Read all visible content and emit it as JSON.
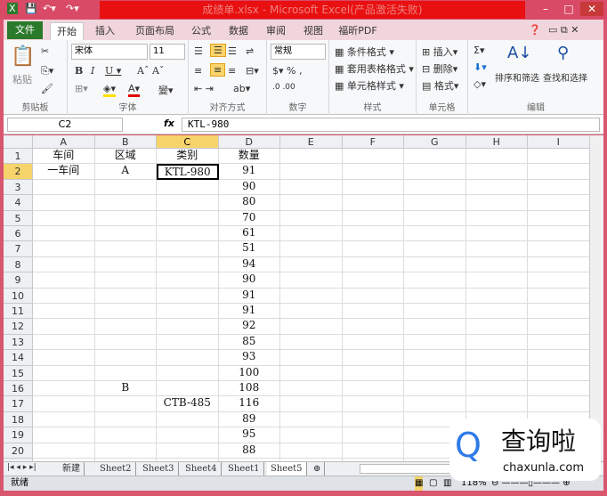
{
  "window": {
    "title": "成绩单.xlsx - Microsoft Excel(产品激活失败)",
    "accent": "#e81010"
  },
  "ribbon_tabs": [
    "文件",
    "开始",
    "插入",
    "页面布局",
    "公式",
    "数据",
    "审阅",
    "视图",
    "福昕PDF"
  ],
  "ribbon": {
    "clipboard": {
      "label": "剪贴板",
      "paste": "粘贴"
    },
    "font": {
      "label": "字体",
      "name": "宋体",
      "size": "11"
    },
    "alignment": {
      "label": "对齐方式"
    },
    "number": {
      "label": "数字",
      "format": "常规"
    },
    "styles": {
      "label": "样式",
      "items": [
        "条件格式",
        "套用表格格式",
        "单元格样式"
      ]
    },
    "cells": {
      "label": "单元格",
      "items": [
        "插入",
        "删除",
        "格式"
      ]
    },
    "editing": {
      "label": "编辑",
      "sort": "排序和筛选",
      "find": "查找和选择"
    }
  },
  "formula_bar": {
    "name_box": "C2",
    "fx": "fx",
    "value": "KTL-980"
  },
  "columns": [
    "A",
    "B",
    "C",
    "D",
    "E",
    "F",
    "G",
    "H",
    "I"
  ],
  "selected_column": "C",
  "rows": [
    [
      "车间",
      "区域",
      "类别",
      "数量"
    ],
    [
      "一车间",
      "A",
      "KTL-980",
      "91"
    ],
    [
      "",
      "",
      "",
      "90"
    ],
    [
      "",
      "",
      "",
      "80"
    ],
    [
      "",
      "",
      "",
      "70"
    ],
    [
      "",
      "",
      "",
      "61"
    ],
    [
      "",
      "",
      "",
      "51"
    ],
    [
      "",
      "",
      "",
      "94"
    ],
    [
      "",
      "",
      "",
      "90"
    ],
    [
      "",
      "",
      "",
      "91"
    ],
    [
      "",
      "",
      "",
      "91"
    ],
    [
      "",
      "",
      "",
      "92"
    ],
    [
      "",
      "",
      "",
      "85"
    ],
    [
      "",
      "",
      "",
      "93"
    ],
    [
      "",
      "",
      "",
      "100"
    ],
    [
      "",
      "B",
      "",
      "108"
    ],
    [
      "",
      "",
      "CTB-485",
      "116"
    ],
    [
      "",
      "",
      "",
      "89"
    ],
    [
      "",
      "",
      "",
      "95"
    ],
    [
      "",
      "",
      "",
      "88"
    ],
    [
      "",
      "",
      "",
      ""
    ]
  ],
  "active_cell": "C2",
  "sheet_tabs": [
    "新建",
    "Sheet2",
    "Sheet3",
    "Sheet4",
    "Sheet1",
    "Sheet5"
  ],
  "active_sheet": "Sheet5",
  "status": {
    "mode": "就绪",
    "zoom": "118%"
  },
  "watermark": {
    "text": "查询啦",
    "url": "chaxunla.com"
  }
}
